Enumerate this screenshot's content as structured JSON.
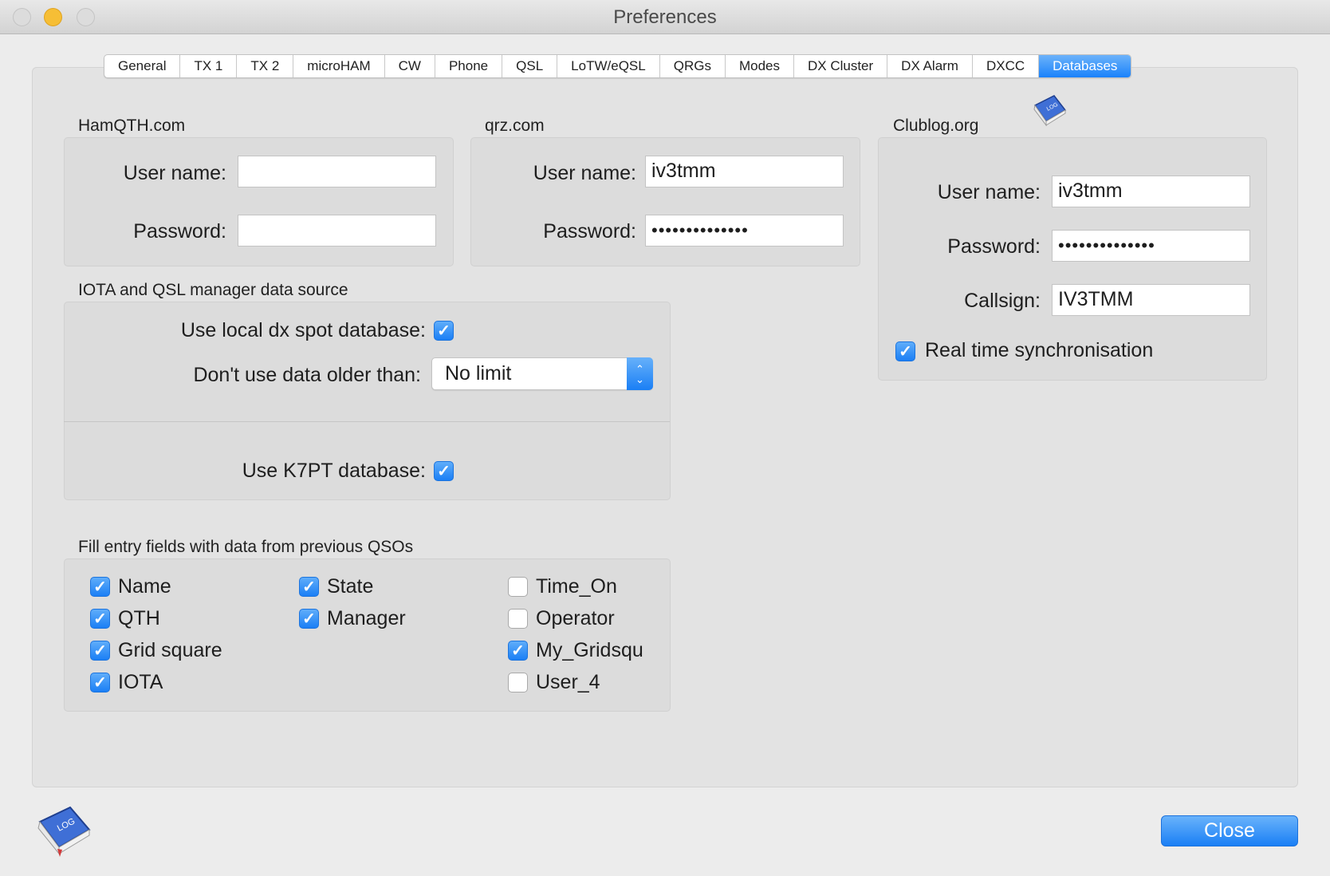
{
  "window": {
    "title": "Preferences"
  },
  "tabs": [
    "General",
    "TX 1",
    "TX 2",
    "microHAM",
    "CW",
    "Phone",
    "QSL",
    "LoTW/eQSL",
    "QRGs",
    "Modes",
    "DX Cluster",
    "DX Alarm",
    "DXCC",
    "Databases"
  ],
  "active_tab": "Databases",
  "hamqth": {
    "title": "HamQTH.com",
    "username_label": "User name:",
    "username_value": "",
    "password_label": "Password:",
    "password_value": ""
  },
  "qrz": {
    "title": "qrz.com",
    "username_label": "User name:",
    "username_value": "iv3tmm",
    "password_label": "Password:",
    "password_value": "••••••••••••••"
  },
  "clublog": {
    "title": "Clublog.org",
    "username_label": "User name:",
    "username_value": "iv3tmm",
    "password_label": "Password:",
    "password_value": "••••••••••••••",
    "callsign_label": "Callsign:",
    "callsign_value": "IV3TMM",
    "realtime_label": "Real time synchronisation",
    "realtime_checked": true
  },
  "iota": {
    "title": "IOTA and QSL manager data source",
    "local_db_label": "Use local dx spot database:",
    "local_db_checked": true,
    "older_label": "Don't use data older than:",
    "older_value": "No limit",
    "k7pt_label": "Use K7PT database:",
    "k7pt_checked": true
  },
  "fill": {
    "title": "Fill entry fields with data from previous QSOs",
    "items": [
      {
        "label": "Name",
        "checked": true
      },
      {
        "label": "QTH",
        "checked": true
      },
      {
        "label": "Grid square",
        "checked": true
      },
      {
        "label": "IOTA",
        "checked": true
      },
      {
        "label": "State",
        "checked": true
      },
      {
        "label": "Manager",
        "checked": true
      },
      {
        "label": "Time_On",
        "checked": false
      },
      {
        "label": "Operator",
        "checked": false
      },
      {
        "label": "My_Gridsqu",
        "checked": true
      },
      {
        "label": "User_4",
        "checked": false
      }
    ]
  },
  "book_icon_text": "LOG",
  "close_button": "Close",
  "colors": {
    "accent": "#1a82fb",
    "window_bg": "#ececec",
    "group_bg": "#dcdcdc"
  },
  "icons": [
    "log-book-icon",
    "up-down-stepper-icon",
    "checkmark-icon"
  ]
}
